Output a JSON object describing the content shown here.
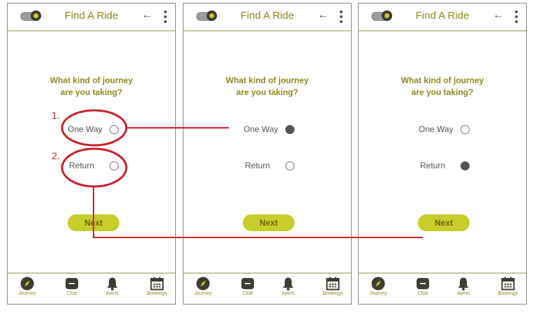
{
  "screens": [
    {
      "title": "Find A Ride",
      "question": [
        "What kind of journey",
        "are you taking?"
      ],
      "options": [
        {
          "label": "One Way",
          "selected": false
        },
        {
          "label": "Return",
          "selected": false
        }
      ],
      "next_label": "Next",
      "nav": [
        "Journey",
        "Chat",
        "Alerts",
        "Bookings"
      ]
    },
    {
      "title": "Find A Ride",
      "question": [
        "What kind of journey",
        "are you taking?"
      ],
      "options": [
        {
          "label": "One Way",
          "selected": true
        },
        {
          "label": "Return",
          "selected": false
        }
      ],
      "next_label": "Next",
      "nav": [
        "Journey",
        "Chat",
        "Alerts",
        "Bookings"
      ]
    },
    {
      "title": "Find A Ride",
      "question": [
        "What kind of journey",
        "are you taking?"
      ],
      "options": [
        {
          "label": "One Way",
          "selected": false
        },
        {
          "label": "Return",
          "selected": true
        }
      ],
      "next_label": "Next",
      "nav": [
        "Journey",
        "Chat",
        "Alerts",
        "Bookings"
      ]
    }
  ],
  "annotations": [
    "1.",
    "2."
  ],
  "colors": {
    "accent": "#c8cd2a",
    "title": "#8f8a1b",
    "annotation": "#c8222a",
    "selected_radio": "#5a5256"
  },
  "icons": [
    "toggle-icon",
    "back-arrow-icon",
    "more-vert-icon",
    "compass-icon",
    "chat-icon",
    "bell-icon",
    "calendar-icon"
  ]
}
